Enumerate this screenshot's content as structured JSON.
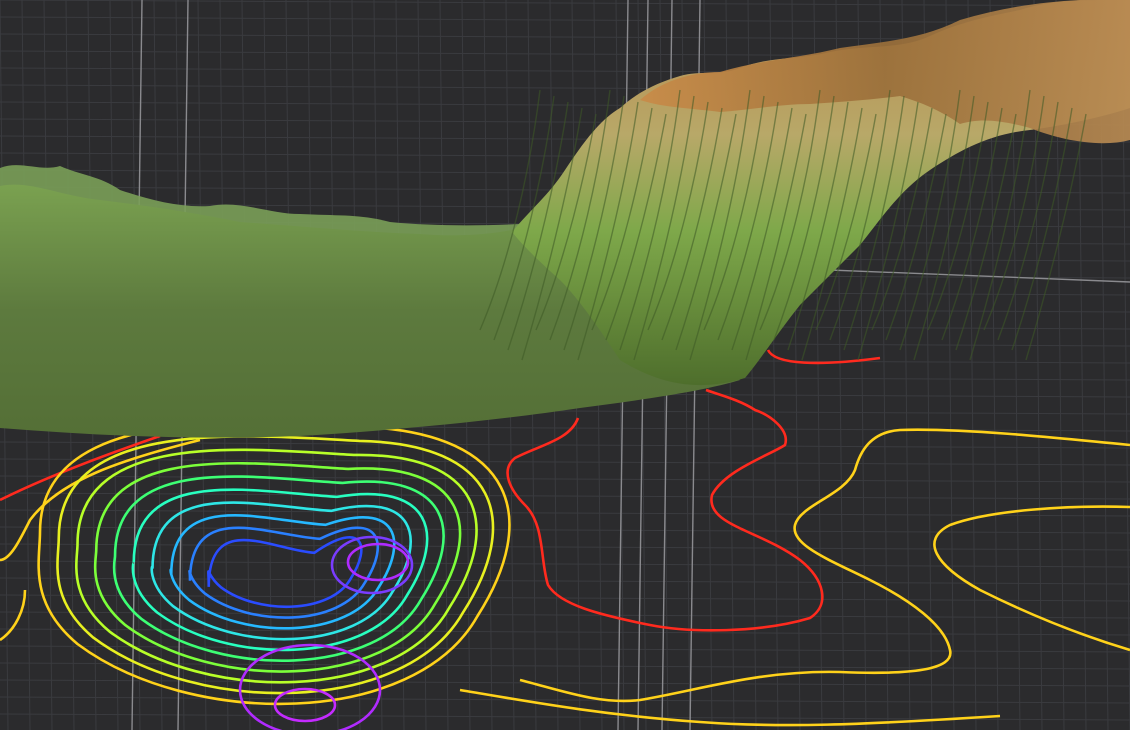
{
  "scene": {
    "colors": {
      "background": "#2b2b2d",
      "grid_minor": "#3d3e42",
      "grid_major": "#8a8a8e",
      "terrain_low": "#5f7f3c",
      "terrain_mid": "#7fae4a",
      "terrain_high": "#c89a5a",
      "contour_red": "#ff2a1e",
      "contour_yellow": "#ffd21a",
      "contour_green": "#7cff3a",
      "contour_cyan": "#2ee6e6",
      "contour_blue": "#2a64ff",
      "contour_violet": "#b02bff"
    },
    "icons": []
  }
}
